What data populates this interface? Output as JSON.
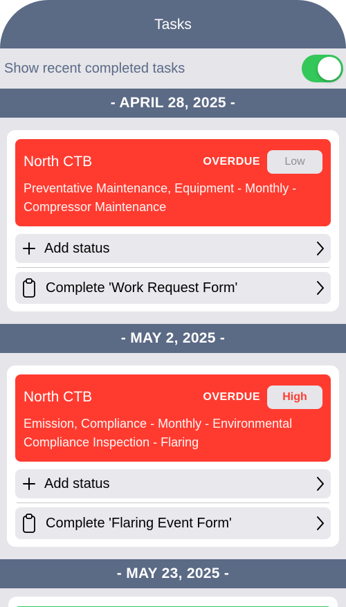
{
  "navbar": {
    "title": "Tasks"
  },
  "filter": {
    "label": "Show recent completed tasks",
    "enabled": true
  },
  "sections": [
    {
      "date": "- APRIL 28, 2025 -",
      "task": {
        "site": "North CTB",
        "status": "OVERDUE",
        "priority": "Low",
        "description": "Preventative Maintenance, Equipment - Monthly - Compressor Maintenance"
      },
      "actions": [
        {
          "label": "Add status",
          "icon": "plus-icon"
        },
        {
          "label": "Complete 'Work Request Form'",
          "icon": "clipboard-icon"
        }
      ]
    },
    {
      "date": "- MAY 2, 2025 -",
      "task": {
        "site": "North CTB",
        "status": "OVERDUE",
        "priority": "High",
        "description": "Emission, Compliance - Monthly - Environmental Compliance Inspection - Flaring"
      },
      "actions": [
        {
          "label": "Add status",
          "icon": "plus-icon"
        },
        {
          "label": "Complete 'Flaring Event Form'",
          "icon": "clipboard-icon"
        }
      ]
    },
    {
      "date": "- MAY 23, 2025 -"
    }
  ],
  "colors": {
    "header": "#5b6a85",
    "overdue_card": "#ff3b30",
    "toggle_on": "#34c759",
    "background": "#e5e5ea"
  }
}
